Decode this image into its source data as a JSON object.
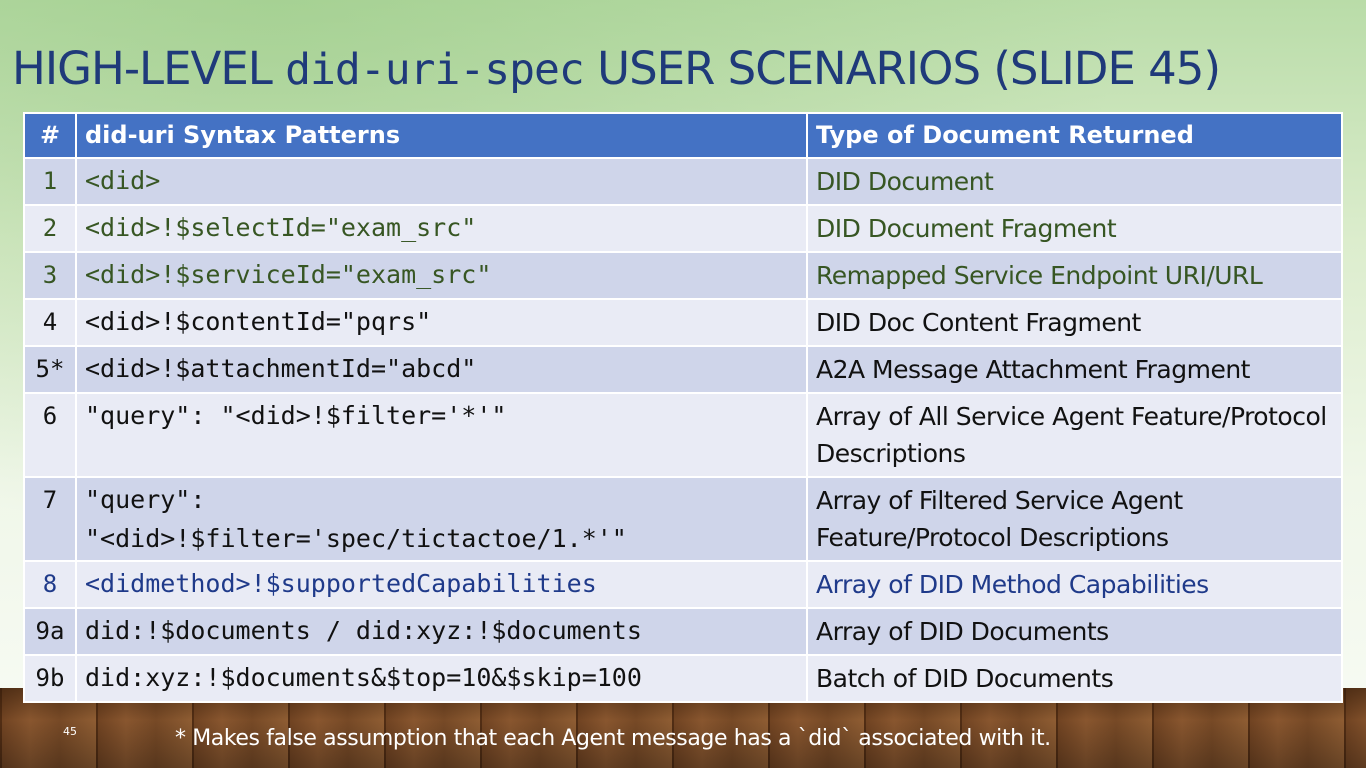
{
  "slide": {
    "title_prefix": "HIGH-LEVEL ",
    "title_code": "did-uri-spec",
    "title_suffix": " USER SCENARIOS (SLIDE 45)",
    "slide_number": "45",
    "footnote": "* Makes false assumption that each Agent message has a `did` associated with it."
  },
  "table": {
    "headers": {
      "num": "#",
      "pattern": "did-uri Syntax Patterns",
      "doc": "Type of Document Returned"
    },
    "rows": [
      {
        "num": "1",
        "pattern": "<did>",
        "doc": "DID Document",
        "color": "#375623"
      },
      {
        "num": "2",
        "pattern": "<did>!$selectId=\"exam_src\"",
        "doc": "DID Document Fragment",
        "color": "#375623"
      },
      {
        "num": "3",
        "pattern": "<did>!$serviceId=\"exam_src\"",
        "doc": "Remapped Service Endpoint URI/URL",
        "color": "#375623"
      },
      {
        "num": "4",
        "pattern": "<did>!$contentId=\"pqrs\"",
        "doc": "DID Doc Content Fragment",
        "color": "#111111"
      },
      {
        "num": "5*",
        "pattern": "<did>!$attachmentId=\"abcd\"",
        "doc": "A2A Message Attachment Fragment",
        "color": "#111111"
      },
      {
        "num": "6",
        "pattern": "\"query\": \"<did>!$filter='*'\"",
        "doc": "Array of All Service Agent Feature/Protocol Descriptions",
        "color": "#111111"
      },
      {
        "num": "7",
        "pattern": "\"query\":\n\"<did>!$filter='spec/tictactoe/1.*'\"",
        "doc": "Array of Filtered Service Agent Feature/Protocol Descriptions",
        "color": "#111111"
      },
      {
        "num": "8",
        "pattern": "<didmethod>!$supportedCapabilities",
        "doc": "Array of DID Method Capabilities",
        "color": "#1f3a8a"
      },
      {
        "num": "9a",
        "pattern": "did:!$documents / did:xyz:!$documents",
        "doc": "Array of DID Documents",
        "color": "#111111"
      },
      {
        "num": "9b",
        "pattern": "did:xyz:!$documents&$top=10&$skip=100",
        "doc": "Batch of DID Documents",
        "color": "#111111"
      }
    ]
  }
}
